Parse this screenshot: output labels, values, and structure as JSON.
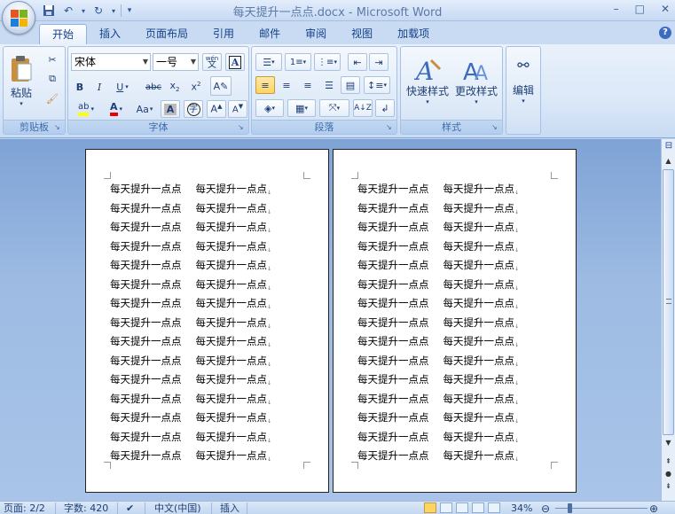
{
  "window": {
    "title": "每天提升一点点.docx - Microsoft Word",
    "controls": [
      "–",
      "□",
      "✕"
    ]
  },
  "qat": {
    "save_icon": "save-icon",
    "undo_icon": "undo-icon",
    "redo_icon": "redo-icon"
  },
  "tabs": [
    {
      "label": "开始",
      "active": true
    },
    {
      "label": "插入"
    },
    {
      "label": "页面布局"
    },
    {
      "label": "引用"
    },
    {
      "label": "邮件"
    },
    {
      "label": "审阅"
    },
    {
      "label": "视图"
    },
    {
      "label": "加载项"
    }
  ],
  "ribbon": {
    "clipboard": {
      "label": "剪贴板",
      "paste": "粘贴"
    },
    "font": {
      "label": "字体",
      "font_name": "宋体",
      "font_size": "一号",
      "wen": "wén"
    },
    "paragraph": {
      "label": "段落"
    },
    "styles": {
      "label": "样式",
      "quick_styles": "快速样式",
      "change_styles": "更改样式"
    },
    "editing": {
      "label": "编辑"
    }
  },
  "document": {
    "line_text": "每天提升一点点",
    "pages": 2,
    "lines_per_page": 15,
    "columns": 2
  },
  "status": {
    "page": "页面: 2/2",
    "words": "字数: 420",
    "language": "中文(中国)",
    "mode": "插入",
    "zoom": "34%"
  }
}
